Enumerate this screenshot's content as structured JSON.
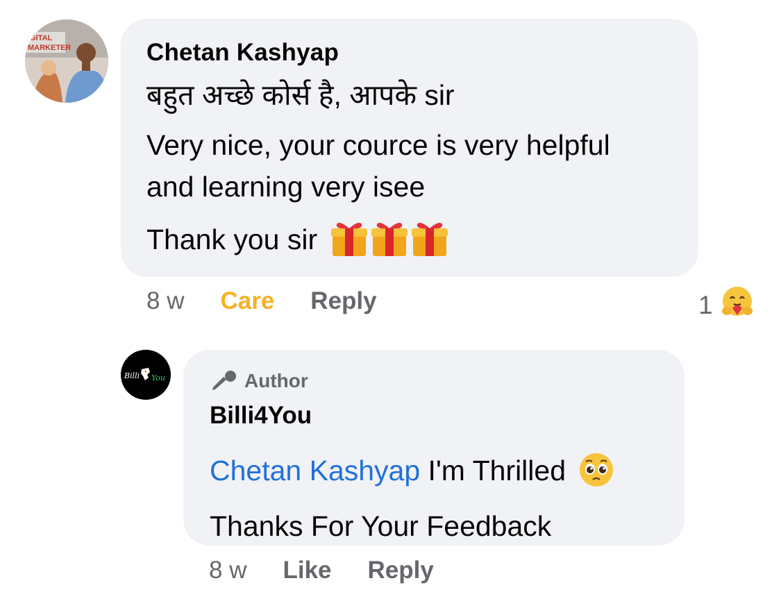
{
  "comment": {
    "author": "Chetan Kashyap",
    "lines": [
      "बहुत अच्छे कोर्स है, आपके sir",
      "Very nice, your cource is very helpful",
      "and learning very isee",
      "Thank you sir"
    ],
    "emoji": [
      "gift-emoji",
      "gift-emoji",
      "gift-emoji"
    ],
    "time": "8 w",
    "reaction_label": "Care",
    "reply_label": "Reply",
    "reaction_count": "1",
    "reaction_icon": "care-emoji",
    "avatar_text": "DIGITAL MARKETER"
  },
  "reply": {
    "badge": "Author",
    "badge_icon": "microphone-icon",
    "author": "Billi4You",
    "mention": "Chetan Kashyap",
    "line1_rest": " I'm Thrilled",
    "line1_emoji": "pleading-face-emoji",
    "line2": "Thanks For Your Feedback",
    "time": "8 w",
    "like_label": "Like",
    "reply_label": "Reply",
    "avatar_text_left": "Billi",
    "avatar_text_right": "You"
  },
  "colors": {
    "bubble": "#f0f2f5",
    "meta": "#65676b",
    "care": "#f7b125",
    "mention": "#216fdb"
  }
}
